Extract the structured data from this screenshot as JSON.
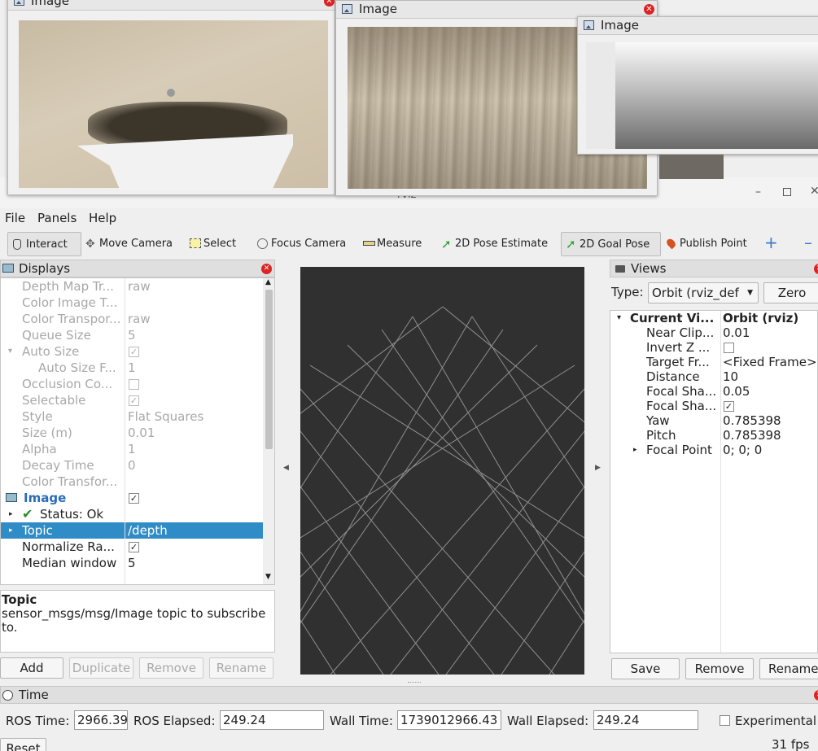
{
  "windows": [
    {
      "title": "Image"
    },
    {
      "title": "Image"
    },
    {
      "title": "Image"
    }
  ],
  "main_window": {
    "title": "rviz"
  },
  "menu": [
    "File",
    "Panels",
    "Help"
  ],
  "tools": [
    {
      "label": "Interact",
      "icon": "hand-icon"
    },
    {
      "label": "Move Camera",
      "icon": "move-camera-icon"
    },
    {
      "label": "Select",
      "icon": "select-icon"
    },
    {
      "label": "Focus Camera",
      "icon": "focus-icon"
    },
    {
      "label": "Measure",
      "icon": "ruler-icon"
    },
    {
      "label": "2D Pose Estimate",
      "icon": "green-arrow-icon"
    },
    {
      "label": "2D Goal Pose",
      "icon": "green-arrow-icon"
    },
    {
      "label": "Publish Point",
      "icon": "map-pin-icon"
    }
  ],
  "displays": {
    "title": "Displays",
    "rows": [
      {
        "key": "Depth Map Tr...",
        "value": "raw"
      },
      {
        "key": "Color Image T...",
        "value": ""
      },
      {
        "key": "Color Transpor...",
        "value": "raw"
      },
      {
        "key": "Queue Size",
        "value": "5"
      },
      {
        "key": "Auto Size",
        "value": ""
      },
      {
        "key": "Auto Size F...",
        "value": "1"
      },
      {
        "key": "Occlusion Co...",
        "value": ""
      },
      {
        "key": "Selectable",
        "value": ""
      },
      {
        "key": "Style",
        "value": "Flat Squares"
      },
      {
        "key": "Size (m)",
        "value": "0.01"
      },
      {
        "key": "Alpha",
        "value": "1"
      },
      {
        "key": "Decay Time",
        "value": "0"
      },
      {
        "key": "Color Transfor...",
        "value": ""
      },
      {
        "key": "Image",
        "value": ""
      },
      {
        "key": "Status: Ok",
        "value": ""
      },
      {
        "key": "Topic",
        "value": "/depth"
      },
      {
        "key": "Normalize Ra...",
        "value": ""
      },
      {
        "key": "Median window",
        "value": "5"
      }
    ],
    "description_title": "Topic",
    "description": "sensor_msgs/msg/Image topic to subscribe to.",
    "buttons": [
      "Add",
      "Duplicate",
      "Remove",
      "Rename"
    ]
  },
  "views": {
    "title": "Views",
    "type_label": "Type:",
    "type_value": "Orbit (rviz_def",
    "zero": "Zero",
    "header_key": "Current Vi...",
    "header_value": "Orbit (rviz)",
    "rows": [
      {
        "key": "Near Clip...",
        "value": "0.01"
      },
      {
        "key": "Invert Z ...",
        "value": ""
      },
      {
        "key": "Target Fr...",
        "value": "<Fixed Frame>"
      },
      {
        "key": "Distance",
        "value": "10"
      },
      {
        "key": "Focal Sha...",
        "value": "0.05"
      },
      {
        "key": "Focal Sha...",
        "value": ""
      },
      {
        "key": "Yaw",
        "value": "0.785398"
      },
      {
        "key": "Pitch",
        "value": "0.785398"
      },
      {
        "key": "Focal Point",
        "value": "0; 0; 0"
      }
    ],
    "buttons": [
      "Save",
      "Remove",
      "Rename"
    ]
  },
  "time": {
    "title": "Time",
    "ros_time_label": "ROS Time:",
    "ros_time": "2966.39",
    "ros_elapsed_label": "ROS Elapsed:",
    "ros_elapsed": "249.24",
    "wall_time_label": "Wall Time:",
    "wall_time": "1739012966.43",
    "wall_elapsed_label": "Wall Elapsed:",
    "wall_elapsed": "249.24",
    "experimental": "Experimental",
    "reset": "Reset",
    "fps": "31 fps"
  }
}
